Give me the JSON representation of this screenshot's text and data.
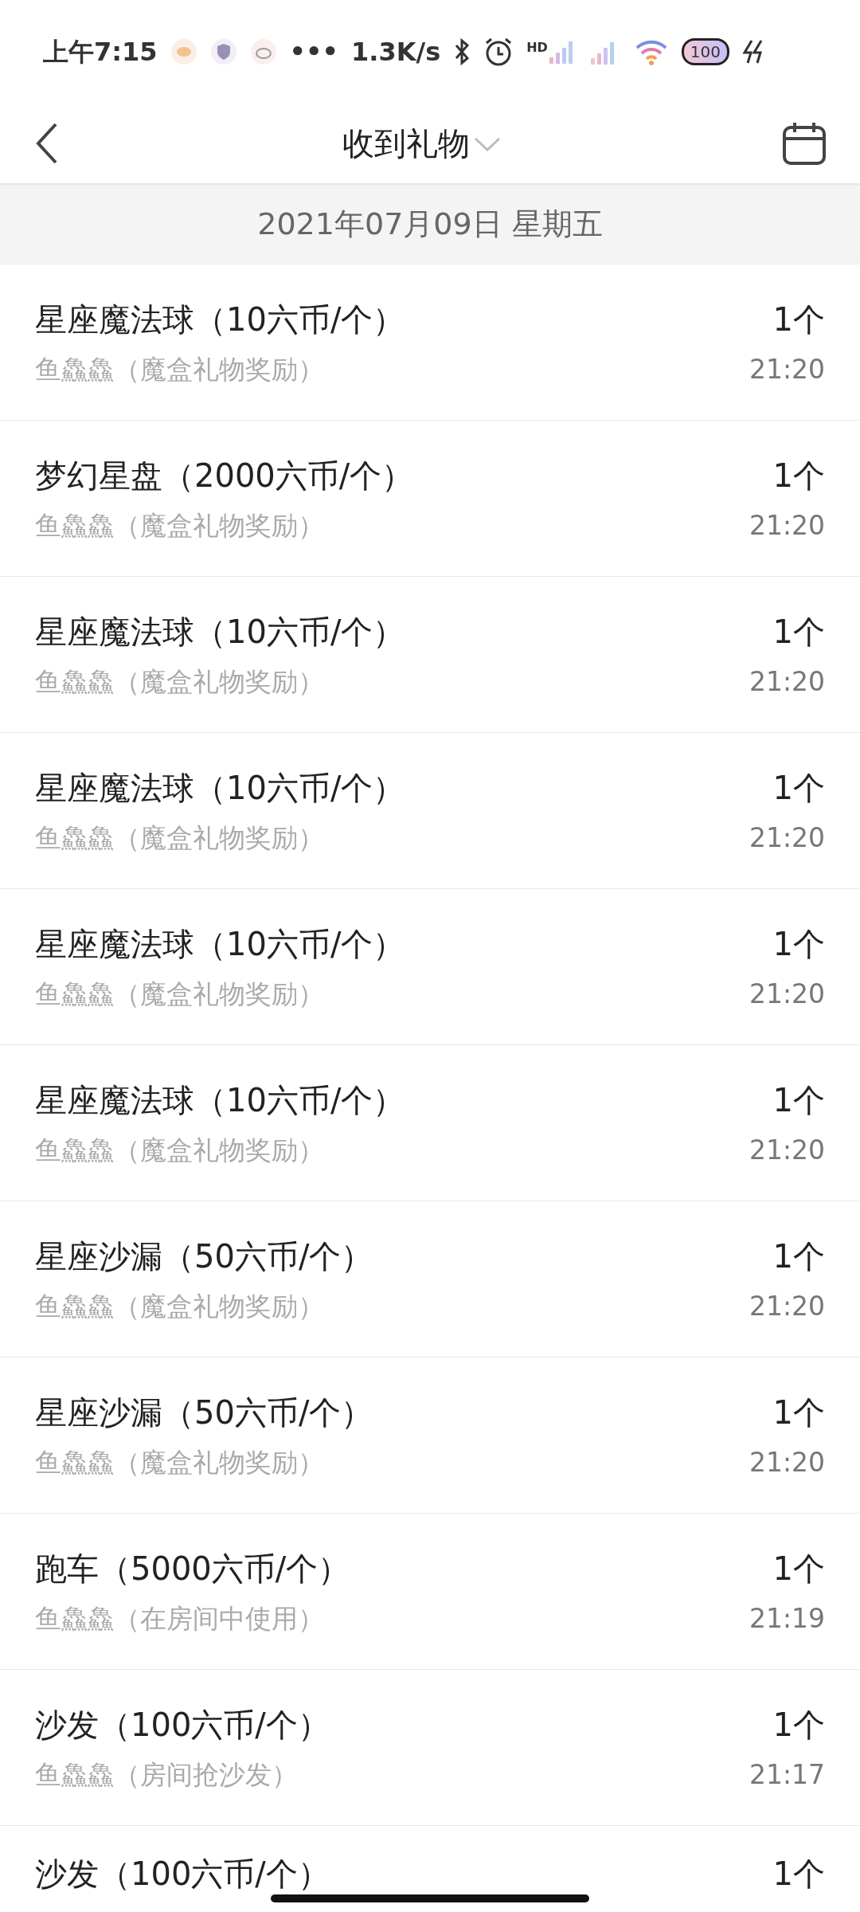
{
  "status_bar": {
    "time": "上午7:15",
    "more": "•••",
    "speed": "1.3K/s",
    "signal_label": "HD",
    "battery": "100"
  },
  "header": {
    "title": "收到礼物"
  },
  "date_header": "2021年07月09日 星期五",
  "rows": [
    {
      "title": "星座魔法球（10六币/个）",
      "source": "鱼鱻鱻（魔盒礼物奖励）",
      "count": "1个",
      "time": "21:20"
    },
    {
      "title": "梦幻星盘（2000六币/个）",
      "source": "鱼鱻鱻（魔盒礼物奖励）",
      "count": "1个",
      "time": "21:20"
    },
    {
      "title": "星座魔法球（10六币/个）",
      "source": "鱼鱻鱻（魔盒礼物奖励）",
      "count": "1个",
      "time": "21:20"
    },
    {
      "title": "星座魔法球（10六币/个）",
      "source": "鱼鱻鱻（魔盒礼物奖励）",
      "count": "1个",
      "time": "21:20"
    },
    {
      "title": "星座魔法球（10六币/个）",
      "source": "鱼鱻鱻（魔盒礼物奖励）",
      "count": "1个",
      "time": "21:20"
    },
    {
      "title": "星座魔法球（10六币/个）",
      "source": "鱼鱻鱻（魔盒礼物奖励）",
      "count": "1个",
      "time": "21:20"
    },
    {
      "title": "星座沙漏（50六币/个）",
      "source": "鱼鱻鱻（魔盒礼物奖励）",
      "count": "1个",
      "time": "21:20"
    },
    {
      "title": "星座沙漏（50六币/个）",
      "source": "鱼鱻鱻（魔盒礼物奖励）",
      "count": "1个",
      "time": "21:20"
    },
    {
      "title": "跑车（5000六币/个）",
      "source": "鱼鱻鱻（在房间中使用）",
      "count": "1个",
      "time": "21:19"
    },
    {
      "title": "沙发（100六币/个）",
      "source": "鱼鱻鱻（房间抢沙发）",
      "count": "1个",
      "time": "21:17"
    },
    {
      "title": "沙发（100六币/个）",
      "count": "1个"
    }
  ]
}
